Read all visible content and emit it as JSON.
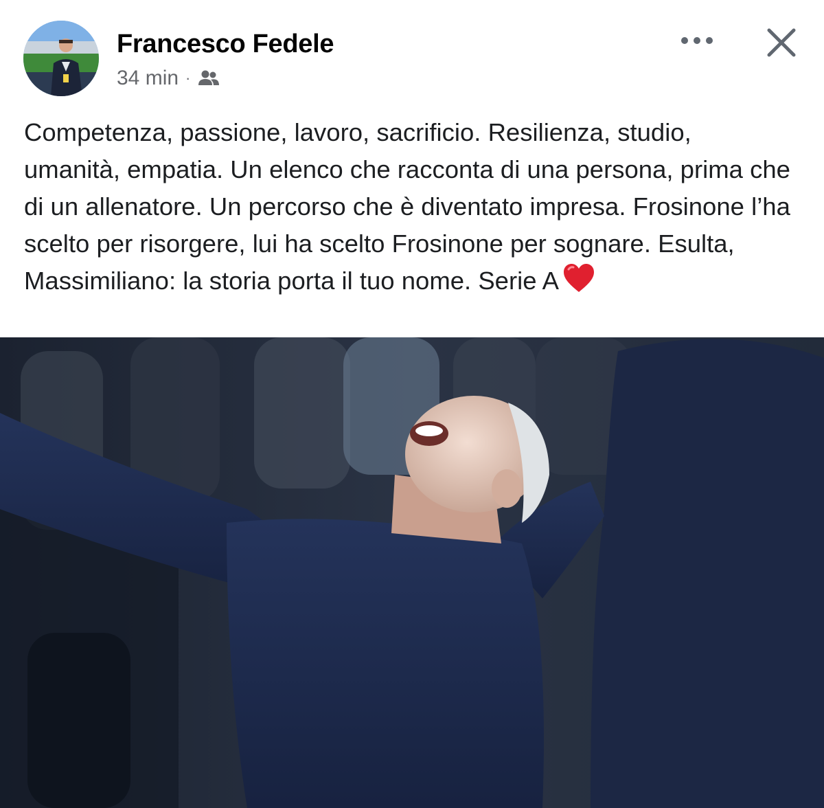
{
  "post": {
    "author_name": "Francesco Fedele",
    "timestamp": "34 min",
    "separator": "·",
    "audience_icon": "friends-icon",
    "body_text": "Competenza, passione, lavoro, sacrificio. Resilienza, studio, umanità, empatia. Un elenco che racconta di una persona, prima che di un allenatore. Un percorso che è diventato impresa. Frosinone l’ha scelto per risorgere, lui ha scelto Frosinone per sognare. Esulta, Massimiliano: la storia porta il tuo nome. Serie A",
    "body_emoji": "red-heart-icon"
  },
  "actions": {
    "more_icon": "more-dots-icon",
    "close_icon": "close-icon"
  },
  "colors": {
    "author": "#050505",
    "secondary_text": "#65676b",
    "body_text": "#1c1e21",
    "icon_gray": "#606770",
    "heart_red": "#e0202f",
    "photo_shirt": "#1e2a4a"
  }
}
